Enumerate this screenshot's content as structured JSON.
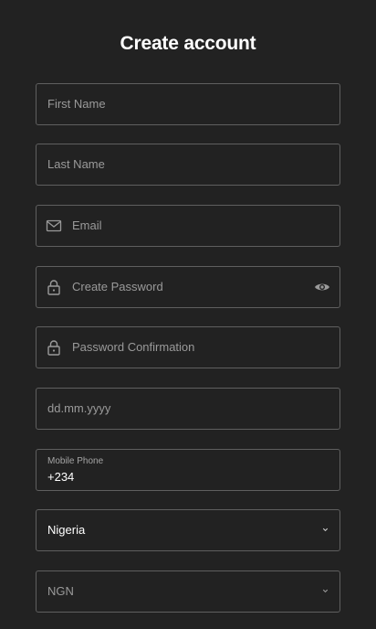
{
  "title": "Create account",
  "fields": {
    "first_name": {
      "placeholder": "First Name"
    },
    "last_name": {
      "placeholder": "Last Name"
    },
    "email": {
      "placeholder": "Email",
      "icon": "mail-icon"
    },
    "password": {
      "placeholder": "Create Password",
      "icon": "lock-icon",
      "toggle_icon": "eye-icon"
    },
    "password_confirmation": {
      "placeholder": "Password Confirmation",
      "icon": "lock-icon"
    },
    "birthdate": {
      "placeholder": "dd.mm.yyyy"
    },
    "mobile_phone": {
      "label": "Mobile Phone",
      "value": "+234"
    },
    "country": {
      "value": "Nigeria",
      "icon": "chevron-down-icon"
    },
    "currency": {
      "placeholder": "NGN",
      "icon": "chevron-down-icon"
    }
  },
  "colors": {
    "background": "#222222",
    "border": "#5f5f5f",
    "placeholder": "#9a9a9a",
    "text": "#ffffff"
  }
}
